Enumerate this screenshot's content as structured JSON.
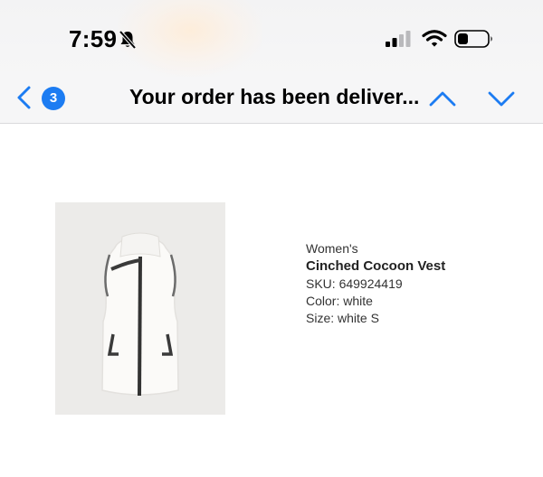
{
  "status_bar": {
    "time": "7:59"
  },
  "nav": {
    "message_count": "3",
    "title": "Your order has been deliver...",
    "accent_color": "#1c7cf2"
  },
  "product": {
    "category": "Women's",
    "name": "Cinched Cocoon Vest",
    "sku": "SKU: 649924419",
    "color": "Color: white",
    "size": "Size: white S"
  },
  "icons": {
    "silent": "bell-slash-icon",
    "signal": "cellular-signal-icon",
    "wifi": "wifi-icon",
    "battery": "battery-icon",
    "back": "chevron-left-icon",
    "up": "chevron-up-icon",
    "down": "chevron-down-icon"
  }
}
